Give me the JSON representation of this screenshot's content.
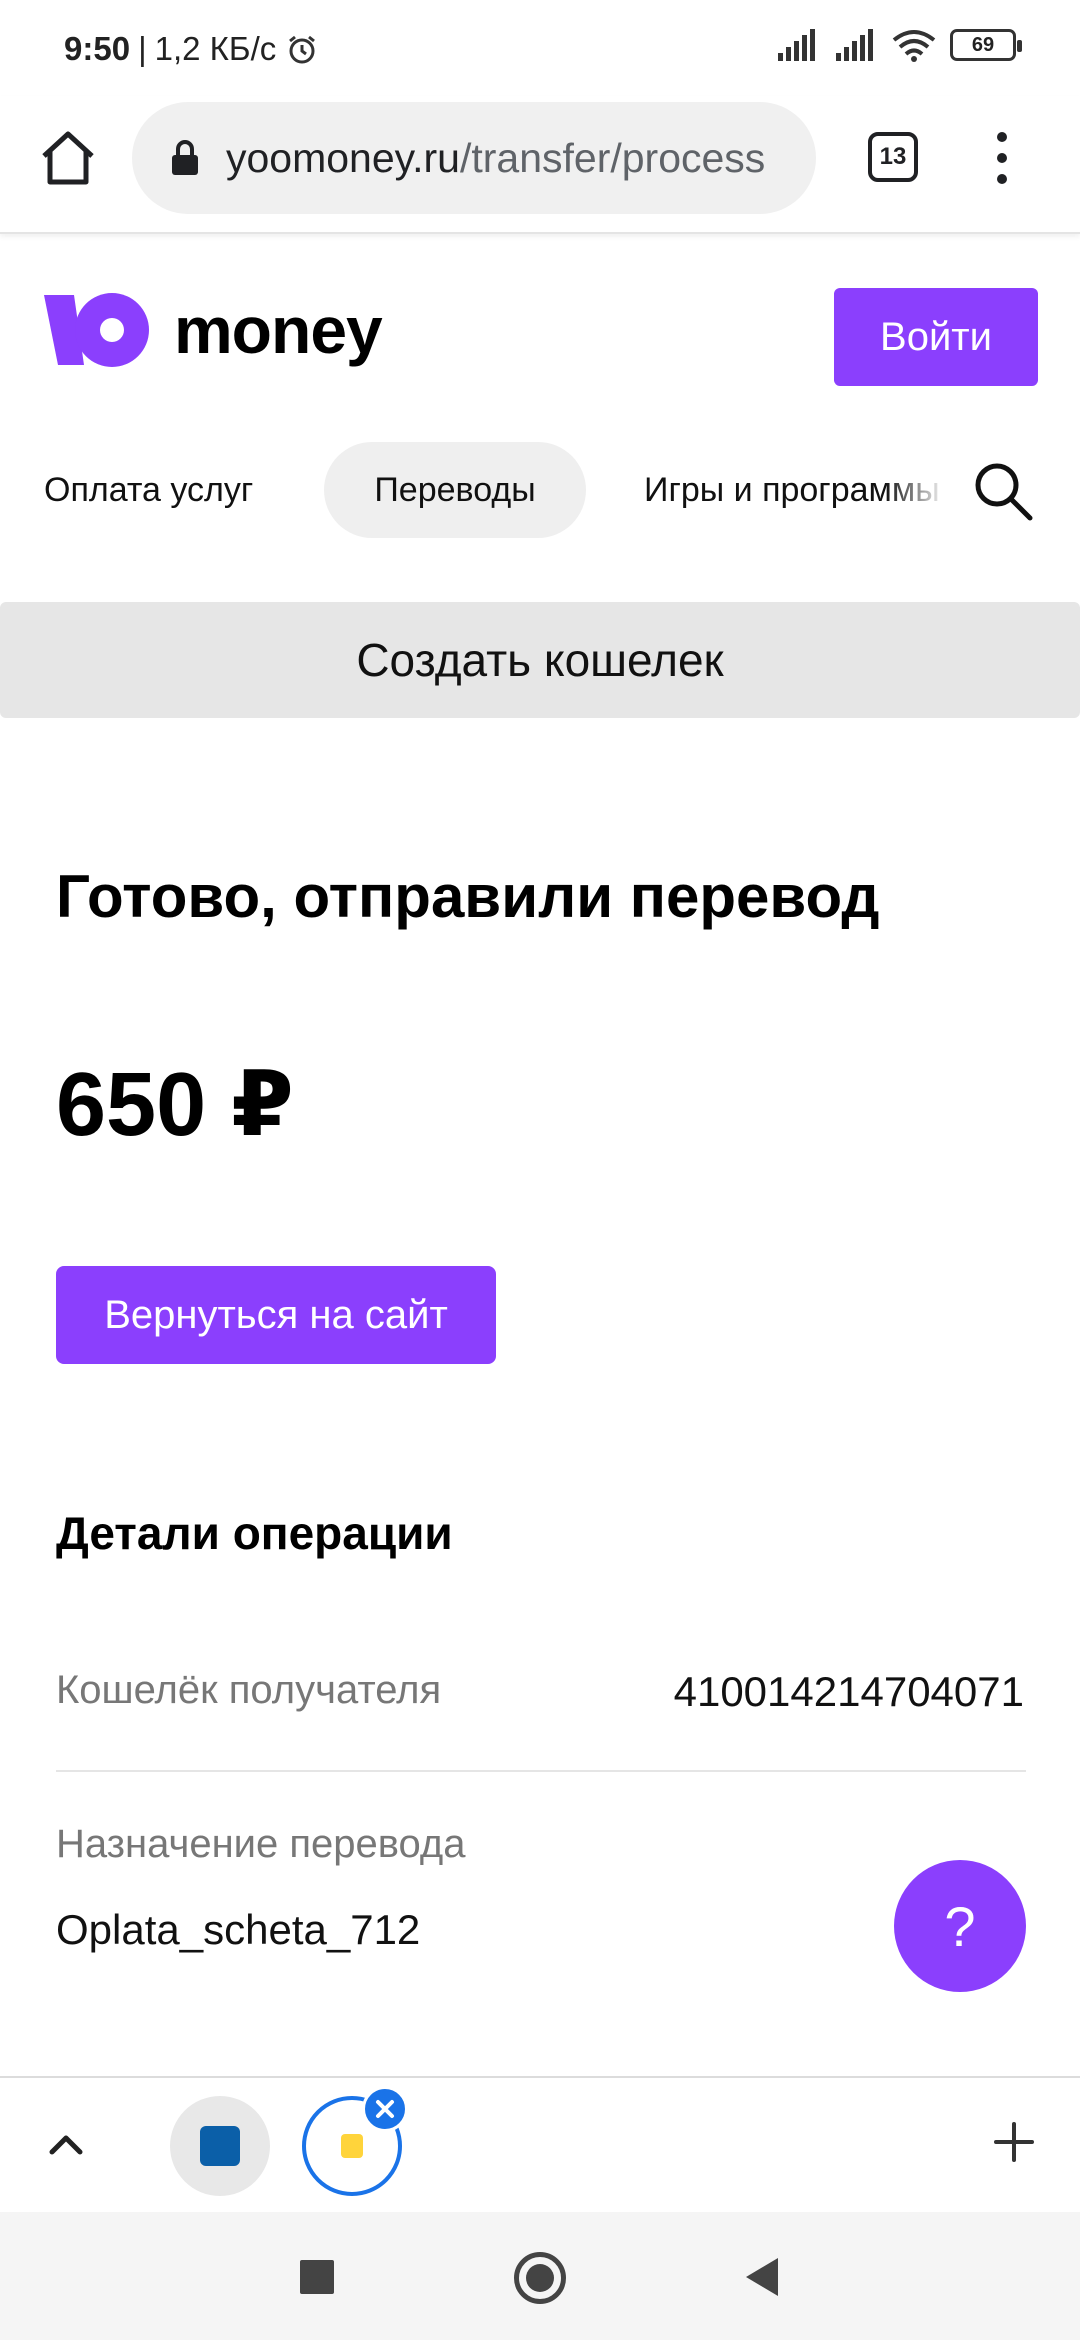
{
  "status_bar": {
    "time": "9:50",
    "speed": "1,2 КБ/с",
    "battery": "69",
    "icons": [
      "alarm-icon",
      "signal-icon",
      "signal-icon",
      "wifi-icon",
      "battery-icon"
    ]
  },
  "browser": {
    "url_host": "yoomoney.ru",
    "url_path": "/transfer/process",
    "tab_count": "13"
  },
  "header": {
    "logo_text": "money",
    "login_label": "Войти",
    "brand_color": "#8b3ffd"
  },
  "nav": {
    "items": [
      {
        "label": "Оплата услуг"
      },
      {
        "label": "Переводы",
        "active": true
      },
      {
        "label": "Игры и программы"
      }
    ]
  },
  "banner": {
    "create_wallet": "Создать кошелек"
  },
  "main": {
    "title": "Готово, отправили перевод",
    "amount": "650 ₽",
    "return_label": "Вернуться на сайт",
    "details_title": "Детали операции",
    "rows": [
      {
        "label": "Кошелёк получателя",
        "value": "410014214704071"
      },
      {
        "label": "Назначение перевода",
        "value": "Oplata_scheta_712"
      }
    ],
    "help_label": "?"
  }
}
